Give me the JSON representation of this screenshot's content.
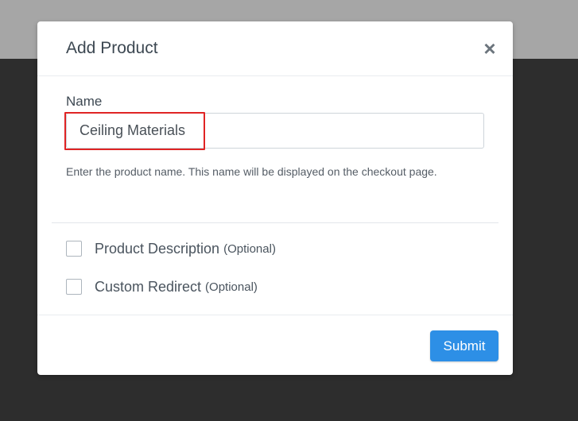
{
  "modal": {
    "title": "Add Product",
    "close_glyph": "×",
    "name_label": "Name",
    "name_value": "Ceiling Materials",
    "help_text": "Enter the product name. This name will be displayed on the checkout page.",
    "options": [
      {
        "label": "Product Description",
        "optional": "(Optional)",
        "checked": false
      },
      {
        "label": "Custom Redirect",
        "optional": "(Optional)",
        "checked": false
      }
    ],
    "submit_label": "Submit"
  },
  "colors": {
    "accent": "#2d8fe6",
    "highlight": "#e02424",
    "overlay_dark": "#2d2d2d",
    "overlay_light": "#a6a6a6"
  },
  "icons": {
    "close": "close-icon"
  }
}
